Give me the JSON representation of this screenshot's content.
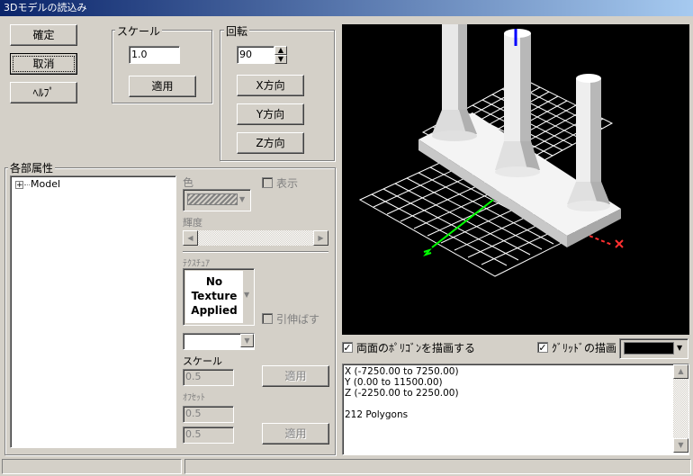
{
  "window": {
    "title": "3Dモデルの読込み"
  },
  "buttons": {
    "ok": "確定",
    "cancel": "取消",
    "help": "ﾍﾙﾌﾟ"
  },
  "scale_group": {
    "label": "スケール",
    "value": "1.0",
    "apply": "適用"
  },
  "rotate_group": {
    "label": "回転",
    "value": "90",
    "x": "X方向",
    "y": "Y方向",
    "z": "Z方向"
  },
  "attributes": {
    "label": "各部属性",
    "tree": {
      "expander": "+",
      "root": "Model"
    },
    "color_label": "色",
    "show_label": "表示",
    "brightness_label": "輝度",
    "texture_label": "ﾃｸｽﾁｭｱ",
    "texture_preview": [
      "No",
      "Texture",
      "Applied"
    ],
    "stretch_label": "引伸ばす",
    "scale_label": "スケール",
    "scale_value": "0.5",
    "scale_apply": "適用",
    "offset_label": "ｵﾌｾｯﾄ",
    "offset_x": "0.5",
    "offset_y": "0.5",
    "offset_apply": "適用"
  },
  "viewport": {
    "draw_backface_label": "両面のﾎﾟﾘｺﾞﾝを描画する",
    "draw_backface_checked": true,
    "draw_grid_label": "ｸﾞﾘｯﾄﾞの描画",
    "draw_grid_checked": true,
    "grid_color": "#000000"
  },
  "info": {
    "x_range": "X (-7250.00 to 7250.00)",
    "y_range": "Y (0.00 to 11500.00)",
    "z_range": "Z (-2250.00 to 2250.00)",
    "polygons": "212 Polygons"
  },
  "colors": {
    "title_start": "#0a246a",
    "title_end": "#a6caf0",
    "axis_x": "#ff3030",
    "axis_y": "#0000ff",
    "axis_z": "#00ff00",
    "grid": "#ffffff"
  }
}
